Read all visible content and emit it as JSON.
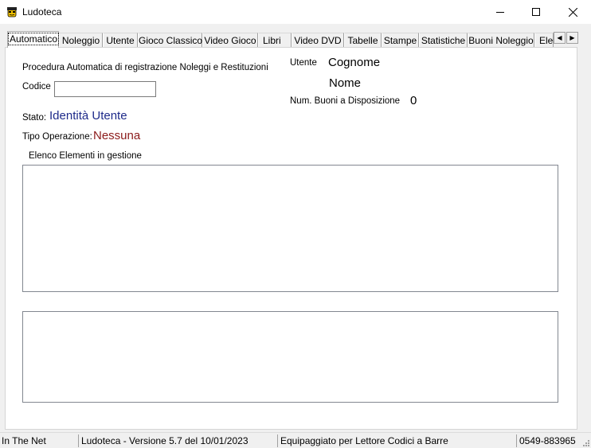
{
  "window": {
    "title": "Ludoteca",
    "icon": "ludoteca-app-icon"
  },
  "tabs": [
    {
      "label": "Automatico",
      "active": true
    },
    {
      "label": "Noleggio"
    },
    {
      "label": "Utente"
    },
    {
      "label": "Gioco Classico"
    },
    {
      "label": "Video Gioco"
    },
    {
      "label": "Libri"
    },
    {
      "label": "Video DVD"
    },
    {
      "label": "Tabelle"
    },
    {
      "label": "Stampe"
    },
    {
      "label": "Statistiche"
    },
    {
      "label": "Buoni Noleggio"
    },
    {
      "label": "Elen"
    }
  ],
  "tab_scroll": {
    "left": "◀",
    "right": "▶"
  },
  "main": {
    "procedure_label": "Procedura Automatica di registrazione Noleggi e Restituzioni",
    "codice_label": "Codice",
    "codice_value": "",
    "stato_label": "Stato:",
    "stato_value": "Identità Utente",
    "tipo_label": "Tipo Operazione:",
    "tipo_value": "Nessuna",
    "utente_label": "Utente",
    "cognome_value": "Cognome",
    "nome_value": "Nome",
    "buoni_label": "Num. Buoni a Disposizione",
    "buoni_value": "0",
    "elenco_label": "Elenco Elementi in gestione"
  },
  "statusbar": {
    "pane1": "In The Net",
    "pane2": "Ludoteca - Versione 5.7 del 10/01/2023",
    "pane3": "Equipaggiato per Lettore Codici a Barre",
    "pane4": "0549-883965"
  },
  "colors": {
    "stato_value": "#1e2a8a",
    "tipo_value": "#8b1a1a"
  }
}
